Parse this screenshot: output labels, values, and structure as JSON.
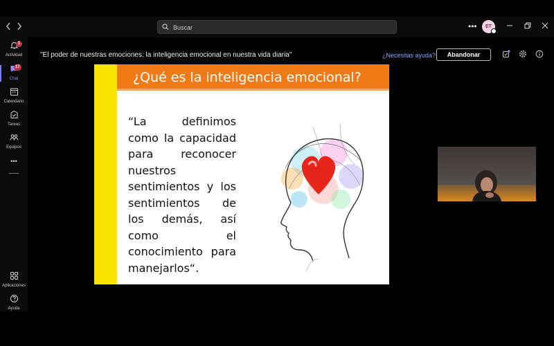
{
  "topbar": {
    "back_icon": "chevron-left-icon",
    "forward_icon": "chevron-right-icon",
    "search": {
      "placeholder": "Buscar",
      "icon": "search-icon"
    },
    "more_icon": "ellipsis-icon",
    "avatar_initials": "ET",
    "window_controls": [
      "minimize-icon",
      "restore-icon",
      "close-icon"
    ]
  },
  "sidebar": {
    "items": [
      {
        "label": "Actividad",
        "icon": "bell-icon",
        "badge": "1"
      },
      {
        "label": "Chat",
        "icon": "chat-icon",
        "badge": "17",
        "active": true
      },
      {
        "label": "Calendario",
        "icon": "calendar-icon"
      },
      {
        "label": "Tareas",
        "icon": "tasks-icon"
      },
      {
        "label": "Equipos",
        "icon": "teams-icon"
      }
    ],
    "more_icon": "ellipsis-icon",
    "bottom_items": [
      {
        "label": "Aplicaciones",
        "icon": "apps-icon"
      },
      {
        "label": "Ayuda",
        "icon": "help-icon"
      }
    ]
  },
  "meeting": {
    "title": "\"El poder de nuestras emociones: la inteligencia emocional en nuestra vida diaria\"",
    "help_link": "¿Necesitas ayuda?",
    "leave_button": "Abandonar",
    "header_icons": [
      "shield-badge-icon",
      "settings-icon",
      "info-icon"
    ]
  },
  "slide": {
    "title": "¿Qué es la inteligencia emocional?",
    "quote": "“La definimos como la capacidad para reconocer nuestros sentimientos y los sentimientos de los demás, así como el conocimiento para manejarlos“.",
    "illustration": "head-silhouette-with-heart-illustration"
  },
  "participant_video": {
    "icon": "participant-video-tile"
  },
  "colors": {
    "accent": "#7b7df0",
    "slide_header": "#f07a16",
    "slide_stripe": "#f7e400",
    "badge": "#c4314b"
  }
}
